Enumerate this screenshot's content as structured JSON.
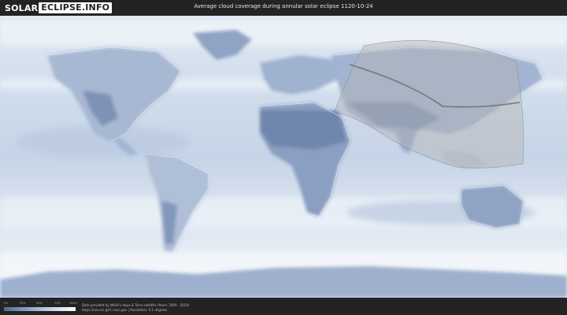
{
  "header": {
    "logo_left": "SOLAR",
    "logo_right": "ECLIPSE.INFO",
    "title": "Average cloud coverage during annular solar eclipse 1120-10-24"
  },
  "legend": {
    "ticks": [
      "0%",
      "25%",
      "50%",
      "75%",
      "100%"
    ],
    "colors": [
      "#4f6991",
      "#8da2c4",
      "#c8d5e7",
      "#ffffff"
    ]
  },
  "footer": {
    "credit_line1": "Data provided by NASA's Aqua & Terra satellite (Years: 2000 - 2019)",
    "credit_line2": "https://neo.sci.gsfc.nasa.gov | Resolution: 0.1 degrees"
  },
  "map": {
    "ocean_color": "#d7e2ef",
    "land_color": "#7f94b9",
    "eclipse_zone_color": "#b4b4b4",
    "central_line_color": "#6e6e6e"
  }
}
